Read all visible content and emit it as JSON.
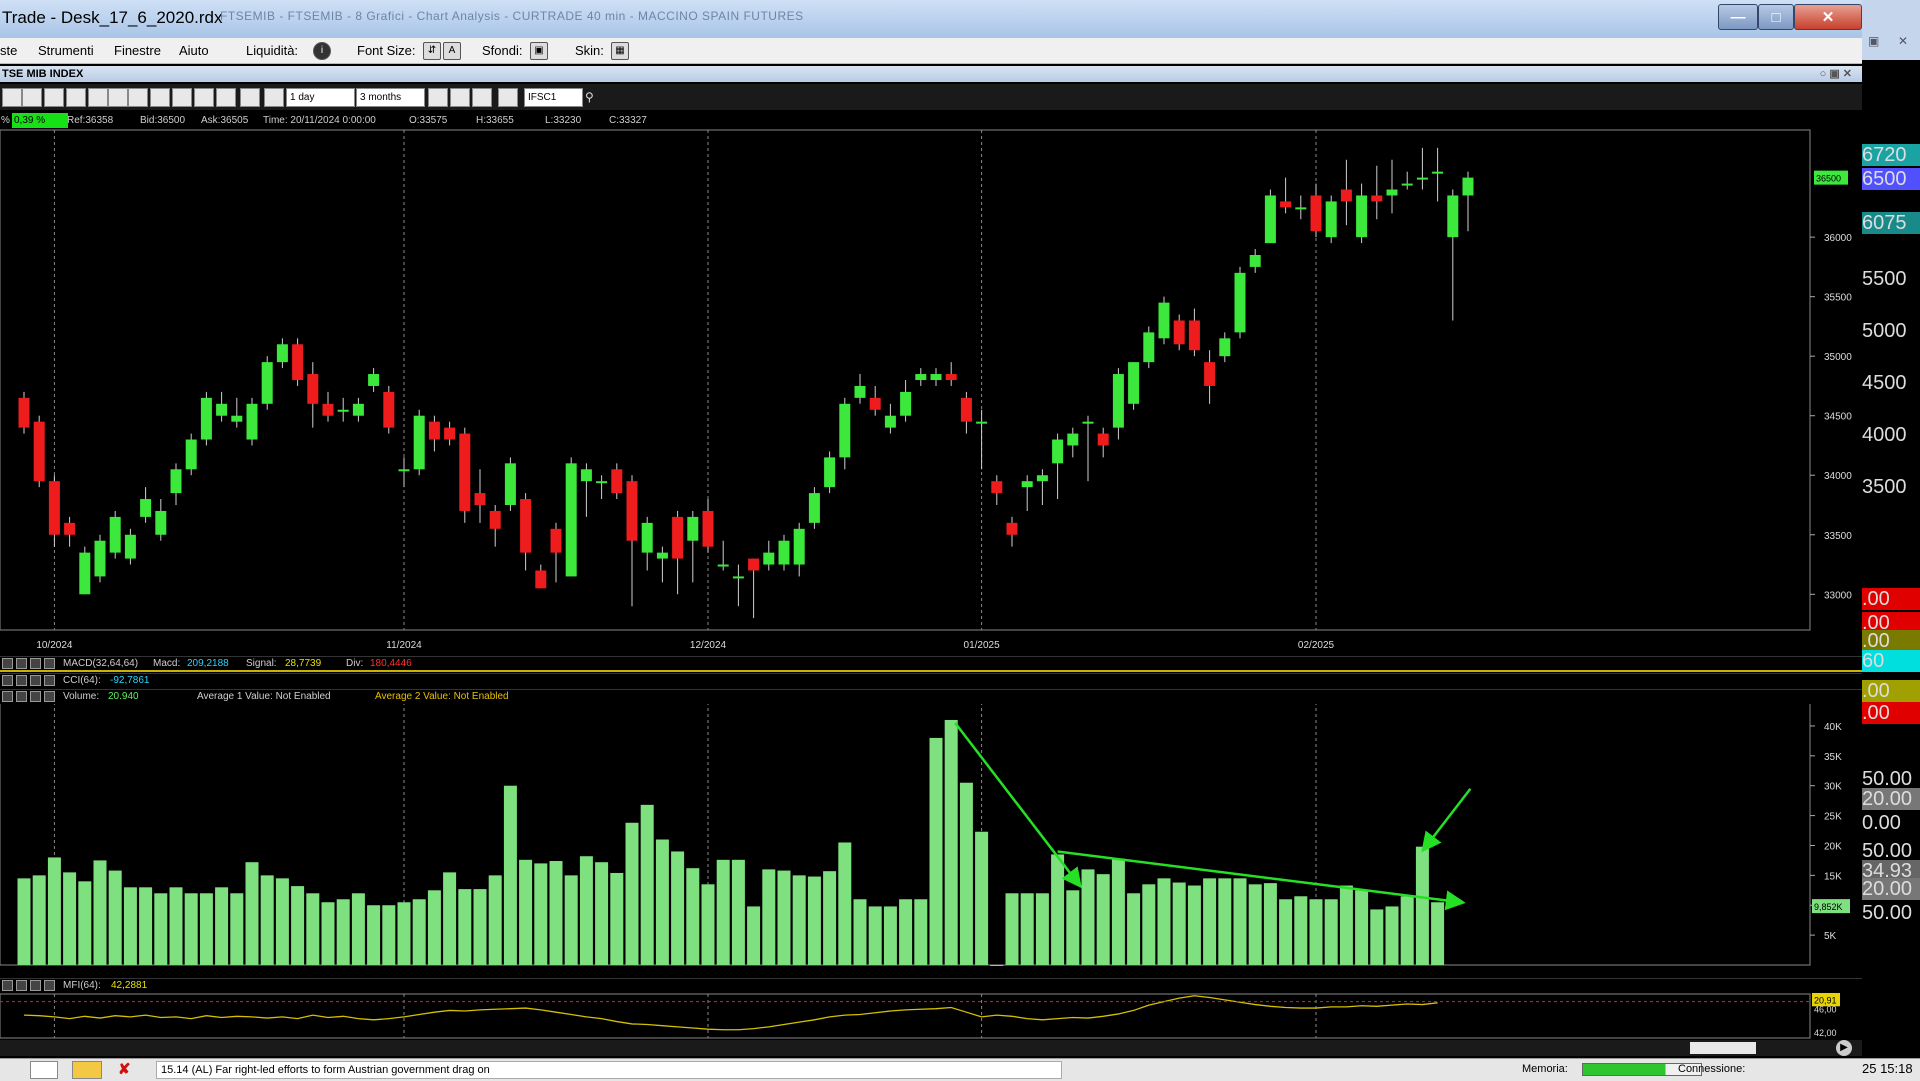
{
  "window": {
    "title": "Trade - Desk_17_6_2020.rdx",
    "blurred_title": "FTSEMIB - FTSEMIB - 8 Grafici - Chart Analysis - CURTRADE 40 min - MACCINO SPAIN FUTURES"
  },
  "menu": {
    "items": [
      "ste",
      "Strumenti",
      "Finestre",
      "Aiuto"
    ],
    "liquidita_label": "Liquidità:",
    "font_size_label": "Font Size:",
    "sfondi_label": "Sfondi:",
    "skin_label": "Skin:"
  },
  "chart_window": {
    "title": "TSE MIB INDEX",
    "interval": "1 day",
    "period": "3 months",
    "symbol": "IFSC1"
  },
  "quote": {
    "pct_label": "%",
    "pct": "0,39 %",
    "ref": "Ref:36358",
    "bid": "Bid:36500",
    "ask": "Ask:36505",
    "time": "Time: 20/11/2024 0:00:00",
    "open": "O:33575",
    "high": "H:33655",
    "low": "L:33230",
    "close": "C:33327"
  },
  "indicators": {
    "macd": {
      "name": "MACD(32,64,64)",
      "macd_label": "Macd:",
      "macd": "209,2188",
      "signal_label": "Signal:",
      "signal": "28,7739",
      "div_label": "Div:",
      "div": "180,4446"
    },
    "cci": {
      "name": "CCI(64):",
      "value": "-92,7861"
    },
    "volume": {
      "name": "Volume:",
      "value": "20.940",
      "avg1": "Average 1 Value:  Not Enabled",
      "avg2": "Average 2 Value:  Not Enabled",
      "current_badge": "9,852K"
    },
    "mfi": {
      "name": "MFI(64):",
      "value": "42,2881",
      "badge": "20,91",
      "ticks": [
        "46,00",
        "42,00"
      ]
    }
  },
  "colors": {
    "up": "#3ce83c",
    "down": "#ee1c1c",
    "volume": "#7ee07e",
    "arrow": "#25e025",
    "background": "#000000"
  },
  "sidepanel": {
    "values": [
      "6720",
      "6500",
      "6075",
      "5500",
      "5000",
      "4500",
      "4000",
      "3500",
      ".00",
      ".00",
      ".00",
      "60",
      ".00",
      ".00",
      "50.00",
      "20.00",
      "0.00",
      "50.00",
      "34.93",
      "20.00",
      "50.00"
    ]
  },
  "status": {
    "news": "15.14 (AL) Far right-led efforts to form Austrian government drag on",
    "memoria_label": "Memoria:",
    "connessione_label": "Connessione:",
    "clock": "25 15:18"
  },
  "chart_data": {
    "type": "candlestick",
    "title": "TSE MIB INDEX",
    "x_tick_labels": [
      "10/2024",
      "11/2024",
      "12/2024",
      "01/2025",
      "02/2025"
    ],
    "price_axis": {
      "ticks": [
        33000,
        33500,
        34000,
        34500,
        35000,
        35500,
        36000
      ],
      "range": [
        32700,
        36900
      ]
    },
    "last_price_badge": "36500",
    "candles": [
      [
        34650,
        34400,
        34700,
        34350
      ],
      [
        34450,
        33950,
        34500,
        33900
      ],
      [
        33950,
        33500,
        34000,
        33400
      ],
      [
        33600,
        33500,
        33650,
        33400
      ],
      [
        33000,
        33350,
        33400,
        33000
      ],
      [
        33150,
        33450,
        33500,
        33100
      ],
      [
        33350,
        33650,
        33700,
        33300
      ],
      [
        33300,
        33500,
        33550,
        33250
      ],
      [
        33650,
        33800,
        33900,
        33600
      ],
      [
        33500,
        33700,
        33800,
        33450
      ],
      [
        33850,
        34050,
        34100,
        33750
      ],
      [
        34050,
        34300,
        34350,
        34000
      ],
      [
        34300,
        34650,
        34700,
        34250
      ],
      [
        34500,
        34600,
        34700,
        34450
      ],
      [
        34450,
        34500,
        34650,
        34400
      ],
      [
        34300,
        34600,
        34650,
        34250
      ],
      [
        34600,
        34950,
        35000,
        34550
      ],
      [
        34950,
        35100,
        35150,
        34900
      ],
      [
        35100,
        34800,
        35150,
        34750
      ],
      [
        34850,
        34600,
        34950,
        34400
      ],
      [
        34600,
        34500,
        34700,
        34450
      ],
      [
        34550,
        34550,
        34650,
        34450
      ],
      [
        34500,
        34600,
        34650,
        34450
      ],
      [
        34750,
        34850,
        34900,
        34700
      ],
      [
        34700,
        34400,
        34750,
        34350
      ],
      [
        34050,
        34050,
        34150,
        33900
      ],
      [
        34050,
        34500,
        34550,
        34000
      ],
      [
        34450,
        34300,
        34500,
        34200
      ],
      [
        34400,
        34300,
        34450,
        34250
      ],
      [
        34350,
        33700,
        34400,
        33600
      ],
      [
        33850,
        33750,
        34050,
        33600
      ],
      [
        33700,
        33550,
        33750,
        33400
      ],
      [
        33750,
        34100,
        34150,
        33700
      ],
      [
        33800,
        33350,
        33850,
        33200
      ],
      [
        33200,
        33050,
        33250,
        33050
      ],
      [
        33550,
        33350,
        33600,
        33100
      ],
      [
        33150,
        34100,
        34150,
        33150
      ],
      [
        33950,
        34050,
        34100,
        33650
      ],
      [
        33950,
        33950,
        34000,
        33800
      ],
      [
        34050,
        33850,
        34100,
        33800
      ],
      [
        33950,
        33450,
        34000,
        32900
      ],
      [
        33350,
        33600,
        33650,
        33200
      ],
      [
        33300,
        33350,
        33400,
        33100
      ],
      [
        33650,
        33300,
        33700,
        33000
      ],
      [
        33450,
        33650,
        33700,
        33100
      ],
      [
        33700,
        33400,
        33800,
        33350
      ],
      [
        33250,
        33250,
        33450,
        33200
      ],
      [
        33150,
        33150,
        33250,
        32900
      ],
      [
        33300,
        33200,
        33300,
        32800
      ],
      [
        33250,
        33350,
        33450,
        33200
      ],
      [
        33250,
        33450,
        33500,
        33200
      ],
      [
        33250,
        33550,
        33600,
        33150
      ],
      [
        33600,
        33850,
        33900,
        33550
      ],
      [
        33900,
        34150,
        34200,
        33850
      ],
      [
        34150,
        34600,
        34650,
        34050
      ],
      [
        34650,
        34750,
        34850,
        34600
      ],
      [
        34650,
        34550,
        34750,
        34500
      ],
      [
        34400,
        34500,
        34600,
        34350
      ],
      [
        34500,
        34700,
        34800,
        34450
      ],
      [
        34800,
        34850,
        34900,
        34750
      ],
      [
        34800,
        34850,
        34900,
        34750
      ],
      [
        34850,
        34800,
        34950,
        34750
      ],
      [
        34650,
        34450,
        34700,
        34350
      ],
      [
        34450,
        34450,
        34550,
        34050
      ],
      [
        33950,
        33850,
        34000,
        33750
      ],
      [
        33600,
        33500,
        33650,
        33400
      ],
      [
        33900,
        33950,
        34000,
        33700
      ],
      [
        33950,
        34000,
        34050,
        33750
      ],
      [
        34100,
        34300,
        34350,
        33800
      ],
      [
        34250,
        34350,
        34400,
        34150
      ],
      [
        34450,
        34450,
        34500,
        33950
      ],
      [
        34350,
        34250,
        34400,
        34150
      ],
      [
        34400,
        34850,
        34900,
        34300
      ],
      [
        34600,
        34950,
        34950,
        34550
      ],
      [
        34950,
        35200,
        35250,
        34900
      ],
      [
        35150,
        35450,
        35500,
        35100
      ],
      [
        35300,
        35100,
        35350,
        35050
      ],
      [
        35300,
        35050,
        35400,
        35000
      ],
      [
        34950,
        34750,
        35050,
        34600
      ],
      [
        35000,
        35150,
        35200,
        34950
      ],
      [
        35200,
        35700,
        35750,
        35150
      ],
      [
        35750,
        35850,
        35900,
        35700
      ],
      [
        35950,
        36350,
        36400,
        35950
      ],
      [
        36300,
        36250,
        36500,
        36200
      ],
      [
        36250,
        36250,
        36350,
        36150
      ],
      [
        36350,
        36050,
        36450,
        36000
      ],
      [
        36000,
        36300,
        36350,
        35950
      ],
      [
        36400,
        36300,
        36650,
        36100
      ],
      [
        36000,
        36350,
        36450,
        35950
      ],
      [
        36350,
        36300,
        36600,
        36150
      ],
      [
        36350,
        36400,
        36650,
        36200
      ],
      [
        36450,
        36450,
        36550,
        36400
      ],
      [
        36500,
        36500,
        36750,
        36400
      ],
      [
        36550,
        36550,
        36750,
        36300
      ],
      [
        36000,
        36350,
        36400,
        35300
      ],
      [
        36350,
        36500,
        36550,
        36050
      ]
    ],
    "volume_axis": {
      "ticks": [
        "5K",
        "10K",
        "15K",
        "20K",
        "25K",
        "30K",
        "35K",
        "40K"
      ],
      "range": [
        0,
        42000
      ]
    },
    "volume": [
      14500,
      15000,
      18000,
      15500,
      14000,
      17500,
      15800,
      13000,
      13000,
      12000,
      13000,
      12000,
      12000,
      13000,
      12000,
      17200,
      15000,
      14500,
      13200,
      12000,
      10500,
      11000,
      12000,
      10000,
      10000,
      10500,
      11000,
      12500,
      15500,
      12700,
      12700,
      15000,
      30000,
      17600,
      17000,
      17400,
      15000,
      18200,
      17200,
      15400,
      23800,
      26800,
      21000,
      19000,
      16200,
      13500,
      17600,
      17600,
      9800,
      16000,
      15800,
      15000,
      14800,
      15700,
      20500,
      11000,
      9800,
      9800,
      11000,
      11000,
      38000,
      41000,
      30500,
      22300,
      0,
      12000,
      12000,
      12000,
      18500,
      12500,
      16000,
      15200,
      17800,
      12000,
      13500,
      14500,
      13800,
      13300,
      14500,
      14500,
      14500,
      13500,
      13700,
      11000,
      11500,
      11000,
      11000,
      13300,
      12500,
      9300,
      9800,
      11500,
      19800,
      10500
    ],
    "mfi_series": [
      44.9,
      44.8,
      44.6,
      44.3,
      44.7,
      44.4,
      44.8,
      44.6,
      44.9,
      44.5,
      44.6,
      44.3,
      44.8,
      44.5,
      44.7,
      44.6,
      44.4,
      44.6,
      44.3,
      44.9,
      44.5,
      44.7,
      44.3,
      44.1,
      44.3,
      44.6,
      45.0,
      45.4,
      45.7,
      45.6,
      45.8,
      45.9,
      46.0,
      46.1,
      45.8,
      45.4,
      45.0,
      44.6,
      44.3,
      43.8,
      43.4,
      43.3,
      43.1,
      42.9,
      42.7,
      42.5,
      42.4,
      42.4,
      42.6,
      42.9,
      43.3,
      43.7,
      44.1,
      44.6,
      44.9,
      45.0,
      45.3,
      45.6,
      45.8,
      45.9,
      46.0,
      46.2,
      45.4,
      44.6,
      44.9,
      44.7,
      44.3,
      44.1,
      44.3,
      44.5,
      44.4,
      44.7,
      45.1,
      45.7,
      46.6,
      47.2,
      47.8,
      48.2,
      47.9,
      47.5,
      47.1,
      46.7,
      46.4,
      46.2,
      46.1,
      46.1,
      46.3,
      46.3,
      46.5,
      46.4,
      46.6,
      46.8,
      46.7,
      47.0
    ],
    "annotations": [
      "green arrow volume decline",
      "green volume trendline",
      "green arrow last volume bar"
    ]
  }
}
